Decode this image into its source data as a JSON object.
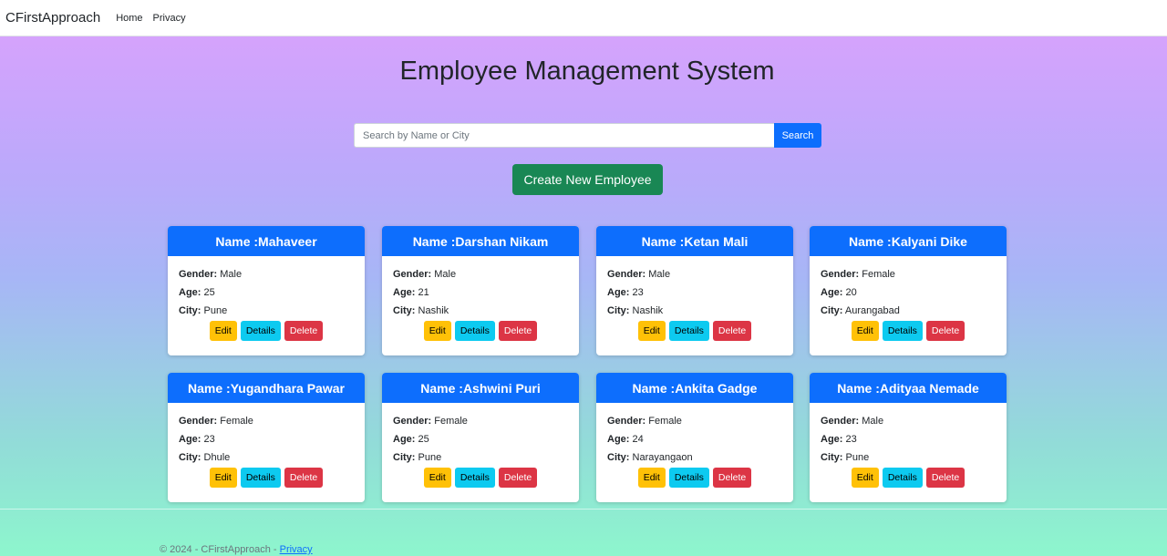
{
  "navbar": {
    "brand": "CFirstApproach",
    "links": [
      "Home",
      "Privacy"
    ]
  },
  "page": {
    "title": "Employee Management System"
  },
  "search": {
    "placeholder": "Search by Name or City",
    "value": "",
    "button_label": "Search"
  },
  "create_button_label": "Create New Employee",
  "labels": {
    "name_prefix": "Name : ",
    "gender": "Gender:",
    "age": "Age:",
    "city": "City:",
    "edit": "Edit",
    "details": "Details",
    "delete": "Delete"
  },
  "employees": [
    {
      "name": "Mahaveer",
      "gender": "Male",
      "age": "25",
      "city": "Pune"
    },
    {
      "name": "Darshan Nikam",
      "gender": "Male",
      "age": "21",
      "city": "Nashik"
    },
    {
      "name": "Ketan Mali",
      "gender": "Male",
      "age": "23",
      "city": "Nashik"
    },
    {
      "name": "Kalyani Dike",
      "gender": "Female",
      "age": "20",
      "city": "Aurangabad"
    },
    {
      "name": "Yugandhara Pawar",
      "gender": "Female",
      "age": "23",
      "city": "Dhule"
    },
    {
      "name": "Ashwini Puri",
      "gender": "Female",
      "age": "25",
      "city": "Pune"
    },
    {
      "name": "Ankita Gadge",
      "gender": "Female",
      "age": "24",
      "city": "Narayangaon"
    },
    {
      "name": "Adityaa Nemade",
      "gender": "Male",
      "age": "23",
      "city": "Pune"
    }
  ],
  "footer": {
    "text": "© 2024 - CFirstApproach - ",
    "link": "Privacy"
  },
  "colors": {
    "primary": "#0d6efd",
    "success": "#198754",
    "warning": "#ffc107",
    "info": "#0dcaf0",
    "danger": "#dc3545"
  }
}
